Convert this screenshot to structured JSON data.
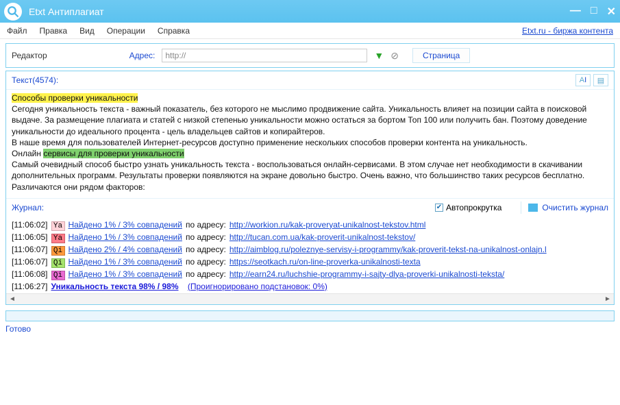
{
  "window": {
    "title": "Etxt Антиплагиат"
  },
  "menu": {
    "items": [
      "Файл",
      "Правка",
      "Вид",
      "Операции",
      "Справка"
    ],
    "external_link": "Etxt.ru - биржа контента"
  },
  "toolbar": {
    "editor_label": "Редактор",
    "address_label": "Адрес:",
    "address_value": "http://",
    "page_tab": "Страница"
  },
  "textpanel": {
    "header": "Текст(4574):",
    "p_hl1": "Способы проверки уникальности",
    "p1": "Сегодня уникальность текста - важный показатель, без которого не мыслимо продвижение сайта. Уникальность влияет на позиции сайта в поисковой выдаче. За размещение плагиата и статей с низкой степенью уникальности можно остаться за бортом Топ 100 или получить бан. Поэтому доведение уникальности до идеального процента - цель владельцев сайтов и копирайтеров.",
    "p2": "В наше время для пользователей Интернет-ресурсов доступно применение нескольких способов проверки контента на уникальность.",
    "p3a": "Онлайн ",
    "p_hl2": "сервисы для проверки уникальности",
    "p4": "Самый очевидный способ быстро узнать уникальность текста - воспользоваться онлайн-сервисами. В этом случае нет необходимости в скачивании дополнительных программ. Результаты проверки появляются на экране довольно быстро. Очень важно, что большинство таких ресурсов бесплатно.",
    "p5": "Различаются они рядом факторов:"
  },
  "journal": {
    "label": "Журнал:",
    "autoscroll": "Автопрокрутка",
    "clear": "Очистить журнал",
    "addr_text": " по адресу: ",
    "lines": [
      {
        "ts": "[11:06:02]",
        "badge": "Ya",
        "badge_cls": "bg-ya1",
        "match": "Найдено 1% / 3% совпадений",
        "url": "http://workion.ru/kak-proveryat-unikalnost-tekstov.html"
      },
      {
        "ts": "[11:06:05]",
        "badge": "Ya",
        "badge_cls": "bg-ya2",
        "match": "Найдено 1% / 3% совпадений",
        "url": "http://tucan.com.ua/kak-proverit-unikalnost-tekstov/"
      },
      {
        "ts": "[11:06:07]",
        "badge": "Qi",
        "badge_cls": "bg-qi1",
        "match": "Найдено 2% / 4% совпадений",
        "url": "http://aimblog.ru/poleznye-servisy-i-programmy/kak-proverit-tekst-na-unikalnost-onlajn.l"
      },
      {
        "ts": "[11:06:07]",
        "badge": "Qi",
        "badge_cls": "bg-qi2",
        "match": "Найдено 1% / 3% совпадений",
        "url": "https://seotkach.ru/on-line-proverka-unikalnosti-texta"
      },
      {
        "ts": "[11:06:08]",
        "badge": "Qi",
        "badge_cls": "bg-qi3",
        "match": "Найдено 1% / 3% совпадений",
        "url": "http://earn24.ru/luchshie-programmy-i-sajty-dlya-proverki-unikalnosti-teksta/"
      }
    ],
    "final_ts": "[11:06:27]",
    "final_text": "Уникальность текста 98% / 98%",
    "final_ignored": "(Проигнорировано подстановок: 0%)"
  },
  "status": {
    "text": "Готово"
  }
}
